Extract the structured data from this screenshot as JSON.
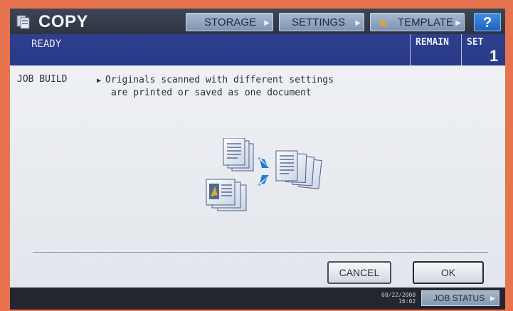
{
  "header": {
    "title": "COPY",
    "app_icon": "copy-icon",
    "storage_label": "STORAGE",
    "settings_label": "SETTINGS",
    "template_label": "TEMPLATE",
    "help_label": "?"
  },
  "status": {
    "text": "READY",
    "remain_label": "REMAIN",
    "set_label": "SET",
    "set_value": "1"
  },
  "content": {
    "job_label": "JOB BUILD",
    "description_line1": "Originals scanned with different settings",
    "description_line2": "are printed or saved as one document",
    "illustration": "job-build-illustration-icon"
  },
  "buttons": {
    "cancel_label": "CANCEL",
    "ok_label": "OK"
  },
  "footer": {
    "date": "08/22/2008",
    "time": "16:02",
    "job_status_label": "JOB STATUS"
  },
  "colors": {
    "bezel": "#e8744f",
    "status_bar": "#2b3c88",
    "help_button": "#2a72d0",
    "content_bg": "#e8eaef"
  }
}
